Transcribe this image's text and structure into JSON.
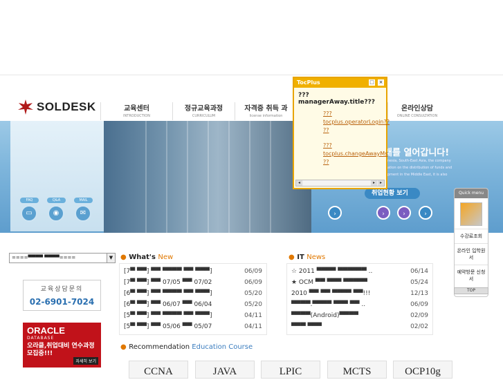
{
  "header": {
    "logo_text": "SOLDESK",
    "nav": [
      {
        "ko": "교육센터",
        "en": "INTRODUCTION"
      },
      {
        "ko": "정규교육과정",
        "en": "CURRICULUM"
      },
      {
        "ko": "자격증 취득 과",
        "en": "license information"
      },
      {
        "ko": "온라인상담",
        "en": "ONLINE CONSULTATION"
      }
    ]
  },
  "hero": {
    "headline": "래를 열어갑니다!",
    "small1": "nesia, South-East Asia, the company",
    "small2": "ation on the distribution of funds and",
    "small3": "pment in the Middle East, it is also",
    "status_button": "취업현황 보기",
    "left_pills": [
      "FAQ",
      "Q&A",
      "MAIL"
    ]
  },
  "popup": {
    "title": "TocPlus",
    "heading": "???managerAway.title???",
    "links": [
      "??? tocplus.operatorLogin?? ??",
      "??? tocplus.changeAwayMs ??"
    ],
    "min_label": "□",
    "close_label": "×"
  },
  "quick_menu": {
    "head": "Quick menu",
    "items": [
      "수강료조회",
      "온라인 입학원서",
      "예약방문 신청서"
    ],
    "top_label": "TOP"
  },
  "sidebar": {
    "select_value": "====▀▀▀▀ ▀▀▀▀====",
    "counsel_title": "교육상담문의",
    "counsel_phone": "02-6901-7024",
    "oracle_l1": "ORACLE",
    "oracle_l2": "DATABASE",
    "oracle_l3a": "오라클,취업대비 연수과정",
    "oracle_l3b": "모집중!!!",
    "oracle_more": "자세히 보기"
  },
  "whats_new": {
    "title_a": "What's ",
    "title_b": "New",
    "rows": [
      {
        "text": "[7▀ ▀▀] ▀▀ ▀▀▀▀ ▀▀ ▀▀▀]",
        "date": "06/09"
      },
      {
        "text": "[7▀ ▀▀] ▀▀ 07/05 ▀▀ 07/02",
        "date": "06/09"
      },
      {
        "text": "[6▀ ▀▀] ▀▀ ▀▀▀▀ ▀▀ ▀▀▀]",
        "date": "05/20"
      },
      {
        "text": "[6▀ ▀▀] ▀▀ 06/07 ▀▀ 06/04",
        "date": "05/20"
      },
      {
        "text": "[5▀ ▀▀] ▀▀ ▀▀▀▀ ▀▀ ▀▀▀]",
        "date": "04/11"
      },
      {
        "text": "[5▀ ▀▀] ▀▀ 05/06 ▀▀ 05/07",
        "date": "04/11"
      }
    ]
  },
  "it_news": {
    "title_a": "IT ",
    "title_b": "News",
    "rows": [
      {
        "text": "☆ 2011 ▀▀▀▀ ▀▀▀▀▀▀ ..",
        "date": "06/14"
      },
      {
        "text": "★ OCM ▀▀ ▀▀▀ ▀▀▀▀▀",
        "date": "05/24"
      },
      {
        "text": "2010 ▀▀ ▀▀ ▀▀▀▀ ▀▀!!!",
        "date": "12/13"
      },
      {
        "text": "▀▀▀▀.▀▀▀▀ ▀▀▀ ▀▀ ..",
        "date": "06/09"
      },
      {
        "text": "▀▀▀▀(Android)▀▀▀▀",
        "date": "02/09"
      },
      {
        "text": "▀▀▀ ▀▀▀",
        "date": "02/02"
      }
    ]
  },
  "recommendation": {
    "title_a": "Recommendation ",
    "title_b": "Education Course",
    "courses": [
      "CCNA",
      "JAVA",
      "LPIC",
      "MCTS",
      "OCP10g"
    ]
  },
  "colors": {
    "accent_orange": "#e07800",
    "accent_blue": "#3b7dbf",
    "popup_gold": "#f0b000",
    "oracle_red": "#c1121a"
  }
}
